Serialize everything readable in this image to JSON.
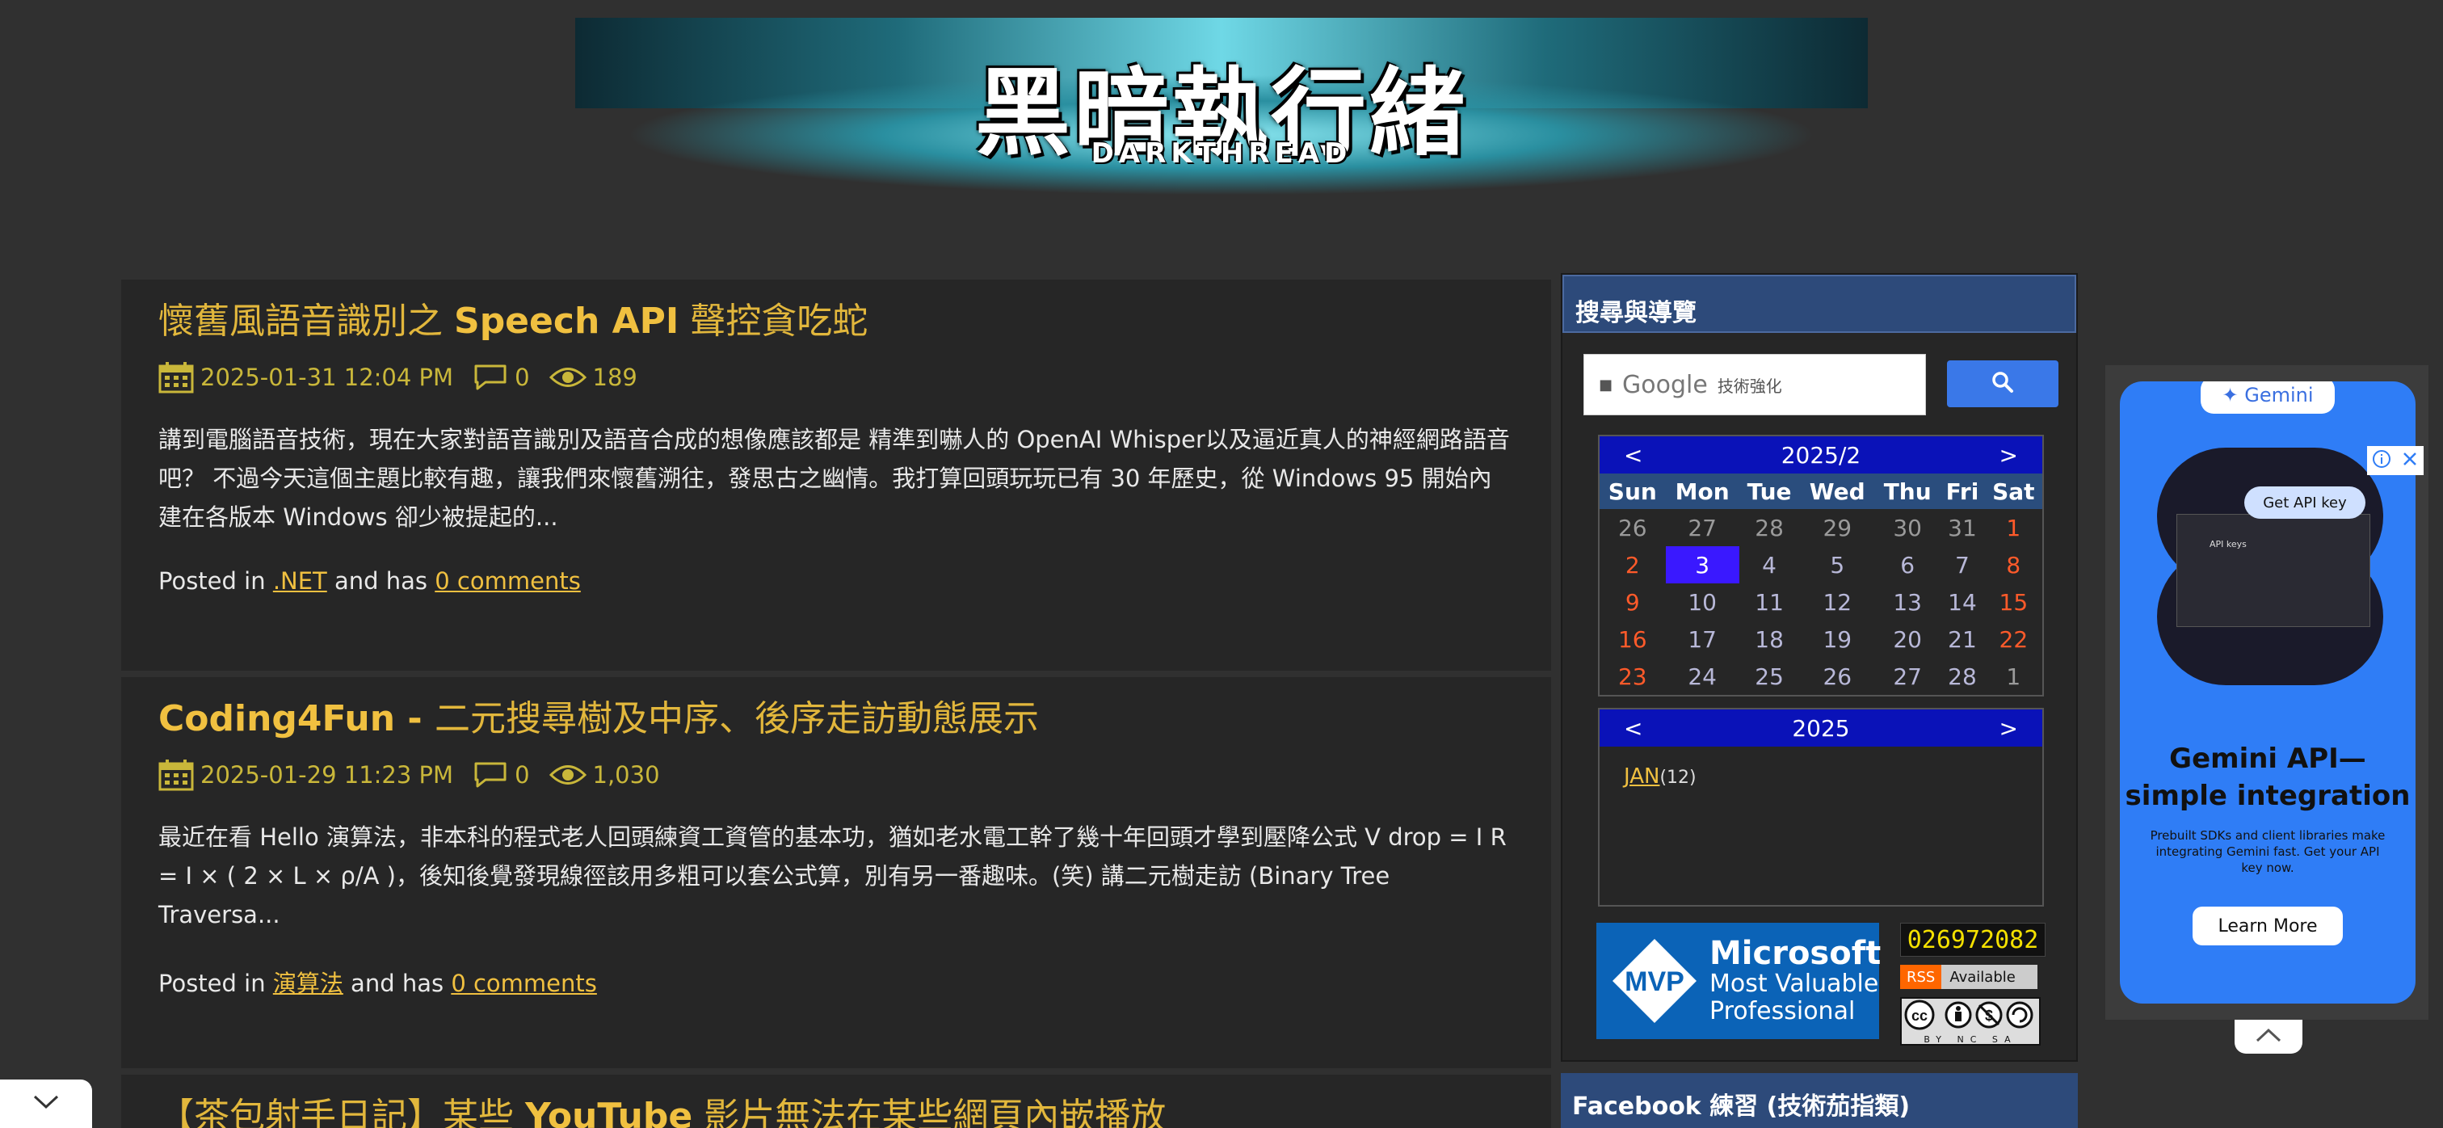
{
  "site": {
    "logo_cn": "黑暗執行緒",
    "logo_en": "DARKTHREAD"
  },
  "posts": [
    {
      "title_part1": "懷舊風語音識別之 ",
      "title_part2": "Speech API",
      "title_part3": " 聲控貪吃蛇",
      "date": "2025-01-31 12:04 PM",
      "comments": "0",
      "views": "189",
      "excerpt": "講到電腦語音技術，現在大家對語音識別及語音合成的想像應該都是 精準到嚇人的 OpenAI Whisper以及逼近真人的神經網路語音吧？ 不過今天這個主題比較有趣，讓我們來懷舊溯往，發思古之幽情。我打算回頭玩玩已有 30 年歷史，從 Windows 95 開始內建在各版本 Windows 卻少被提起的...",
      "posted_in": "Posted in ",
      "category": ".NET",
      "and_has": " and has ",
      "comments_link": "0 comments"
    },
    {
      "title_part1": "Coding4Fun - ",
      "title_part2": "",
      "title_part3": "二元搜尋樹及中序、後序走訪動態展示",
      "date": "2025-01-29 11:23 PM",
      "comments": "0",
      "views": "1,030",
      "excerpt": "最近在看 Hello 演算法，非本科的程式老人回頭練資工資管的基本功，猶如老水電工幹了幾十年回頭才學到壓降公式 V drop = I R = I × ( 2 × L × ρ/A )，後知後覺發現線徑該用多粗可以套公式算，別有另一番趣味。(笑) 講二元樹走訪 (Binary Tree Traversa...",
      "posted_in": "Posted in ",
      "category": "演算法",
      "and_has": " and has ",
      "comments_link": "0 comments"
    },
    {
      "title_part1": "【茶包射手日記】某些 ",
      "title_part2": "YouTube",
      "title_part3": " 影片無法在某些網頁內嵌播放"
    }
  ],
  "sidebar": {
    "section_title": "搜尋與導覽",
    "search": {
      "label": "Google",
      "sub": "技術強化",
      "icon": "search-icon"
    },
    "calendar": {
      "prev": "<",
      "next": ">",
      "month_label": "2025/2",
      "weekdays": [
        "Sun",
        "Mon",
        "Tue",
        "Wed",
        "Thu",
        "Fri",
        "Sat"
      ],
      "weeks": [
        [
          "26",
          "27",
          "28",
          "29",
          "30",
          "31",
          "1"
        ],
        [
          "2",
          "3",
          "4",
          "5",
          "6",
          "7",
          "8"
        ],
        [
          "9",
          "10",
          "11",
          "12",
          "13",
          "14",
          "15"
        ],
        [
          "16",
          "17",
          "18",
          "19",
          "20",
          "21",
          "22"
        ],
        [
          "23",
          "24",
          "25",
          "26",
          "27",
          "28",
          "1"
        ]
      ],
      "today": "3"
    },
    "year": {
      "prev": "<",
      "next": ">",
      "label": "2025",
      "month": "JAN",
      "count": "(12)"
    },
    "mvp": {
      "badge": "MVP",
      "line1": "Microsoft",
      "line2": "Most Valuable",
      "line3": "Professional"
    },
    "counter": "026972082",
    "rss_tag": "RSS",
    "rss_status": "Available",
    "cc_label": "BY NC SA",
    "section2_title": "Facebook 練習 (技術茄指類)"
  },
  "ad": {
    "brand": "✦ Gemini",
    "button_top": "Get API key",
    "screen_title": "API keys",
    "headline1": "Gemini API—",
    "headline2": "simple integration",
    "body": "Prebuilt SDKs and client libraries make integrating Gemini fast. Get your API key now.",
    "cta": "Learn More"
  },
  "colors": {
    "background": "#303030",
    "post_bg": "#262626",
    "title": "#e2b73c",
    "meta": "#c9b73a",
    "link": "#f0c040",
    "calendar_head": "#0a12b8",
    "today": "#3a18ff",
    "weekend": "#ff5a2a",
    "ad_blue": "#2f7df6"
  }
}
